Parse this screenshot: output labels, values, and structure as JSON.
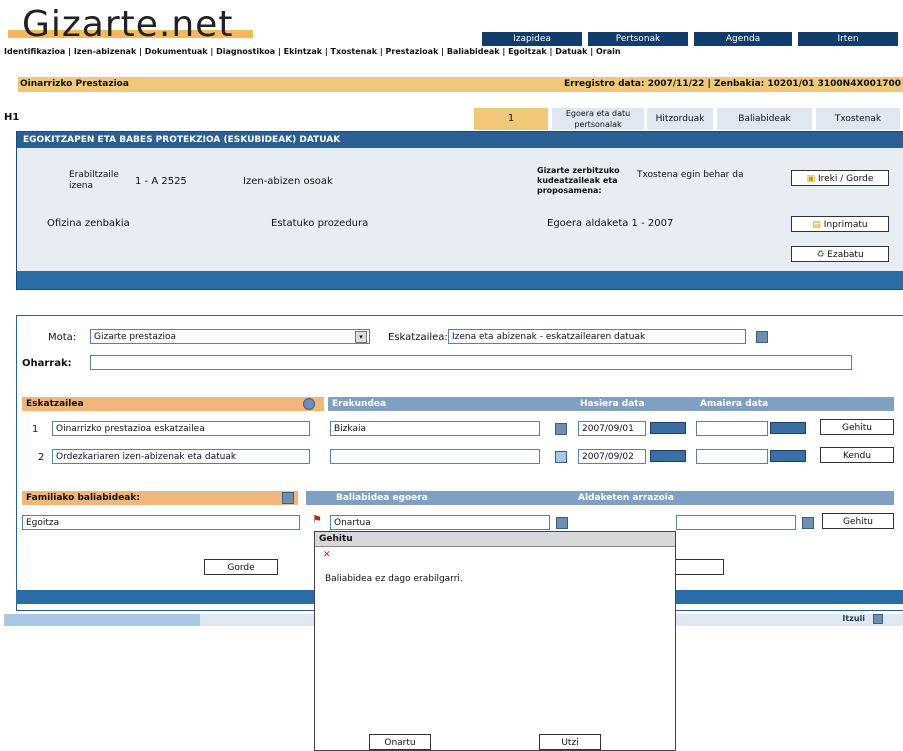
{
  "logo": "Gizarte.net",
  "nav": [
    "Izapidea",
    "Pertsonak",
    "Agenda",
    "Irten"
  ],
  "links_bar": "Identifikazioa | Izen-abizenak | Dokumentuak | Diagnostikoa | Ekintzak | Txostenak | Prestazioak | Baliabideak | Egoitzak | Datuak | Orain",
  "title_left": "Oinarrizko Prestazioa",
  "title_right": "Erregistro data: 2007/11/22 | Zenbakia: 10201/01 3100N4X001700",
  "marker": "H1",
  "tabs": [
    "1",
    "Egoera eta datu pertsonalak",
    "Hitzorduak",
    "Baliabideak",
    "Txostenak"
  ],
  "section1": {
    "header": "EGOKITZAPEN ETA BABES PROTEKZIOA (ESKUBIDEAK) DATUAK",
    "row1": {
      "label": "Erabiltzaile izena",
      "value": "1 - A 2525",
      "mid": "Izen-abizen osoak",
      "right_label": "Gizarte zerbitzuko kudeatzaileak eta proposamena:",
      "right_value": "Txostena egin behar da",
      "btn": "Ireki / Gorde"
    },
    "row2": {
      "label": "Ofizina zenbakia",
      "mid": "Estatuko prozedura",
      "right": "Egoera aldaketa 1 - 2007",
      "btn": "Inprimatu"
    },
    "row3": {
      "btn": "Ezabatu"
    }
  },
  "form": {
    "type_label": "Mota:",
    "type_value": "Gizarte prestazioa",
    "req_label": "Eskatzailea:",
    "req_value": "Izena eta abizenak - eskatzailearen datuak",
    "note_label": "Oharrak:",
    "note_value": ""
  },
  "grid1": {
    "headers": [
      "Eskatzailea",
      "Erakundea",
      "Hasiera data",
      "Amaiera data"
    ],
    "rows": [
      {
        "num": "1",
        "name": "Oinarrizko prestazioa eskatzailea",
        "org": "Bizkaia",
        "date1": "2007/09/01",
        "btn": "Gehitu"
      },
      {
        "num": "2",
        "name": "Ordezkariaren izen-abizenak eta datuak",
        "org": "",
        "date1": "2007/09/02",
        "btn": "Kendu"
      }
    ]
  },
  "grid2": {
    "headers": [
      "Familiako baliabideak:",
      "Baliabidea egoera",
      "Aldaketen arrazoia"
    ],
    "row": {
      "value": "Egoitza",
      "state": "Onartua",
      "btn": "Gehitu"
    }
  },
  "buttons": {
    "bottom_left": "Gorde",
    "bottom_right": ""
  },
  "footer": {
    "right_label": "Itzuli"
  },
  "popup": {
    "title": "Gehitu",
    "content": "Baliabidea ez dago erabilgarri.",
    "ok": "Onartu",
    "cancel": "Utzi"
  }
}
